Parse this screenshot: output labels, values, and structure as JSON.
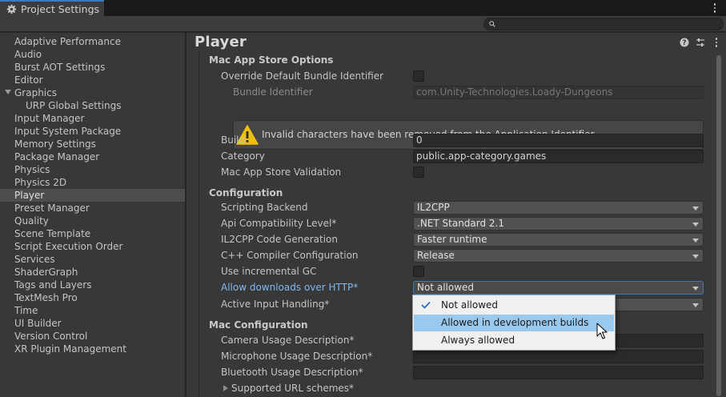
{
  "window": {
    "tab_title": "Project Settings"
  },
  "sidebar": {
    "items": [
      {
        "label": "Adaptive Performance"
      },
      {
        "label": "Audio"
      },
      {
        "label": "Burst AOT Settings"
      },
      {
        "label": "Editor"
      },
      {
        "label": "Graphics"
      },
      {
        "label": "URP Global Settings"
      },
      {
        "label": "Input Manager"
      },
      {
        "label": "Input System Package"
      },
      {
        "label": "Memory Settings"
      },
      {
        "label": "Package Manager"
      },
      {
        "label": "Physics"
      },
      {
        "label": "Physics 2D"
      },
      {
        "label": "Player"
      },
      {
        "label": "Preset Manager"
      },
      {
        "label": "Quality"
      },
      {
        "label": "Scene Template"
      },
      {
        "label": "Script Execution Order"
      },
      {
        "label": "Services"
      },
      {
        "label": "ShaderGraph"
      },
      {
        "label": "Tags and Layers"
      },
      {
        "label": "TextMesh Pro"
      },
      {
        "label": "Time"
      },
      {
        "label": "UI Builder"
      },
      {
        "label": "Version Control"
      },
      {
        "label": "XR Plugin Management"
      }
    ],
    "selected": "Player"
  },
  "main": {
    "title": "Player",
    "mac_app_store": {
      "section": "Mac App Store Options",
      "override_label": "Override Default Bundle Identifier",
      "bundle_label": "Bundle Identifier",
      "bundle_value": "com.Unity-Technologies.Loady-Dungeons",
      "warning": "Invalid characters have been removed from the Application Identifier.",
      "build_label": "Build",
      "build_value": "0",
      "category_label": "Category",
      "category_value": "public.app-category.games",
      "validation_label": "Mac App Store Validation"
    },
    "configuration": {
      "section": "Configuration",
      "scripting_backend_label": "Scripting Backend",
      "scripting_backend_value": "IL2CPP",
      "api_label": "Api Compatibility Level*",
      "api_value": ".NET Standard 2.1",
      "il2cpp_gen_label": "IL2CPP Code Generation",
      "il2cpp_gen_value": "Faster runtime",
      "cpp_label": "C++ Compiler Configuration",
      "cpp_value": "Release",
      "incremental_label": "Use incremental GC",
      "http_label": "Allow downloads over HTTP*",
      "http_value": "Not allowed",
      "input_label": "Active Input Handling*"
    },
    "mac_config": {
      "section": "Mac Configuration",
      "camera_label": "Camera Usage Description*",
      "mic_label": "Microphone Usage Description*",
      "bluetooth_label": "Bluetooth Usage Description*",
      "url_schemes_label": "Supported URL schemes*"
    }
  },
  "popup": {
    "options": [
      {
        "label": "Not allowed"
      },
      {
        "label": "Allowed in development builds"
      },
      {
        "label": "Always allowed"
      }
    ]
  },
  "colors": {
    "accent": "#3a79bb",
    "link": "#7db8ef",
    "highlight": "#99c9ef",
    "warning": "#f0c000"
  }
}
